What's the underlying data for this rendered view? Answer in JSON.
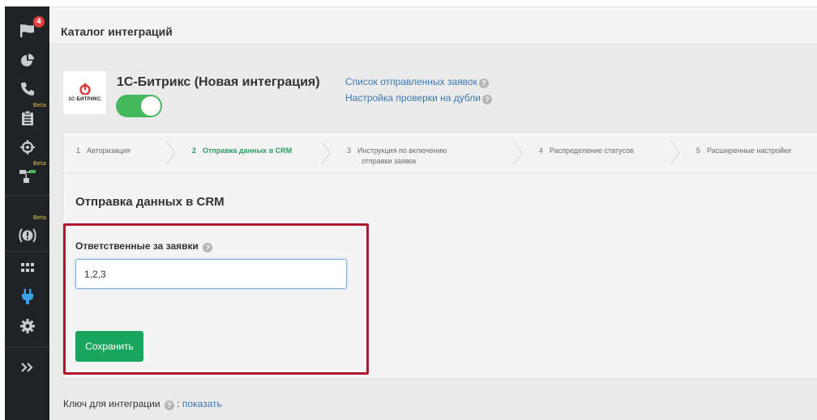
{
  "sidebar": {
    "notification_count": "4",
    "beta_label": "Beta",
    "items": [
      {
        "icon": "flag-icon"
      },
      {
        "icon": "pie-chart-icon"
      },
      {
        "icon": "phone-icon"
      },
      {
        "icon": "clipboard-icon",
        "beta": true
      },
      {
        "icon": "target-icon"
      },
      {
        "icon": "sitemap-icon",
        "beta": true
      },
      {
        "icon": "alert-icon",
        "beta": true
      },
      {
        "icon": "grid-icon"
      },
      {
        "icon": "plug-icon",
        "active": true
      },
      {
        "icon": "gear-icon"
      },
      {
        "icon": "double-chevron-right-icon"
      }
    ]
  },
  "header": {
    "title": "Каталог интеграций"
  },
  "integration": {
    "logo_text": "1С-БИТРИКС",
    "title": "1С-Битрикс (Новая интеграция)",
    "enabled": true,
    "links": [
      {
        "label": "Список отправленных заявок"
      },
      {
        "label": "Настройка проверки на дубли"
      }
    ]
  },
  "steps": [
    {
      "num": "1",
      "label": "Авторизация"
    },
    {
      "num": "2",
      "label": "Отправка данных в CRM",
      "active": true
    },
    {
      "num": "3",
      "label": "Инструкция по включению",
      "label2": "отправки заявок"
    },
    {
      "num": "4",
      "label": "Распределение статусов"
    },
    {
      "num": "5",
      "label": "Расширенные настройки"
    }
  ],
  "section": {
    "title": "Отправка данных в CRM",
    "field_label": "Ответственные за заявки",
    "field_value": "1,2,3",
    "save_label": "Сохранить"
  },
  "footer": {
    "key_label": "Ключ для интеграции",
    "separator": ":",
    "show_label": "показать"
  },
  "colors": {
    "sidebar_bg": "#1f2326",
    "accent_green": "#19a55d",
    "active_step": "#2d9c62",
    "link": "#3b77b5",
    "highlight": "#b3162c",
    "plug_icon": "#3aa3e8"
  }
}
